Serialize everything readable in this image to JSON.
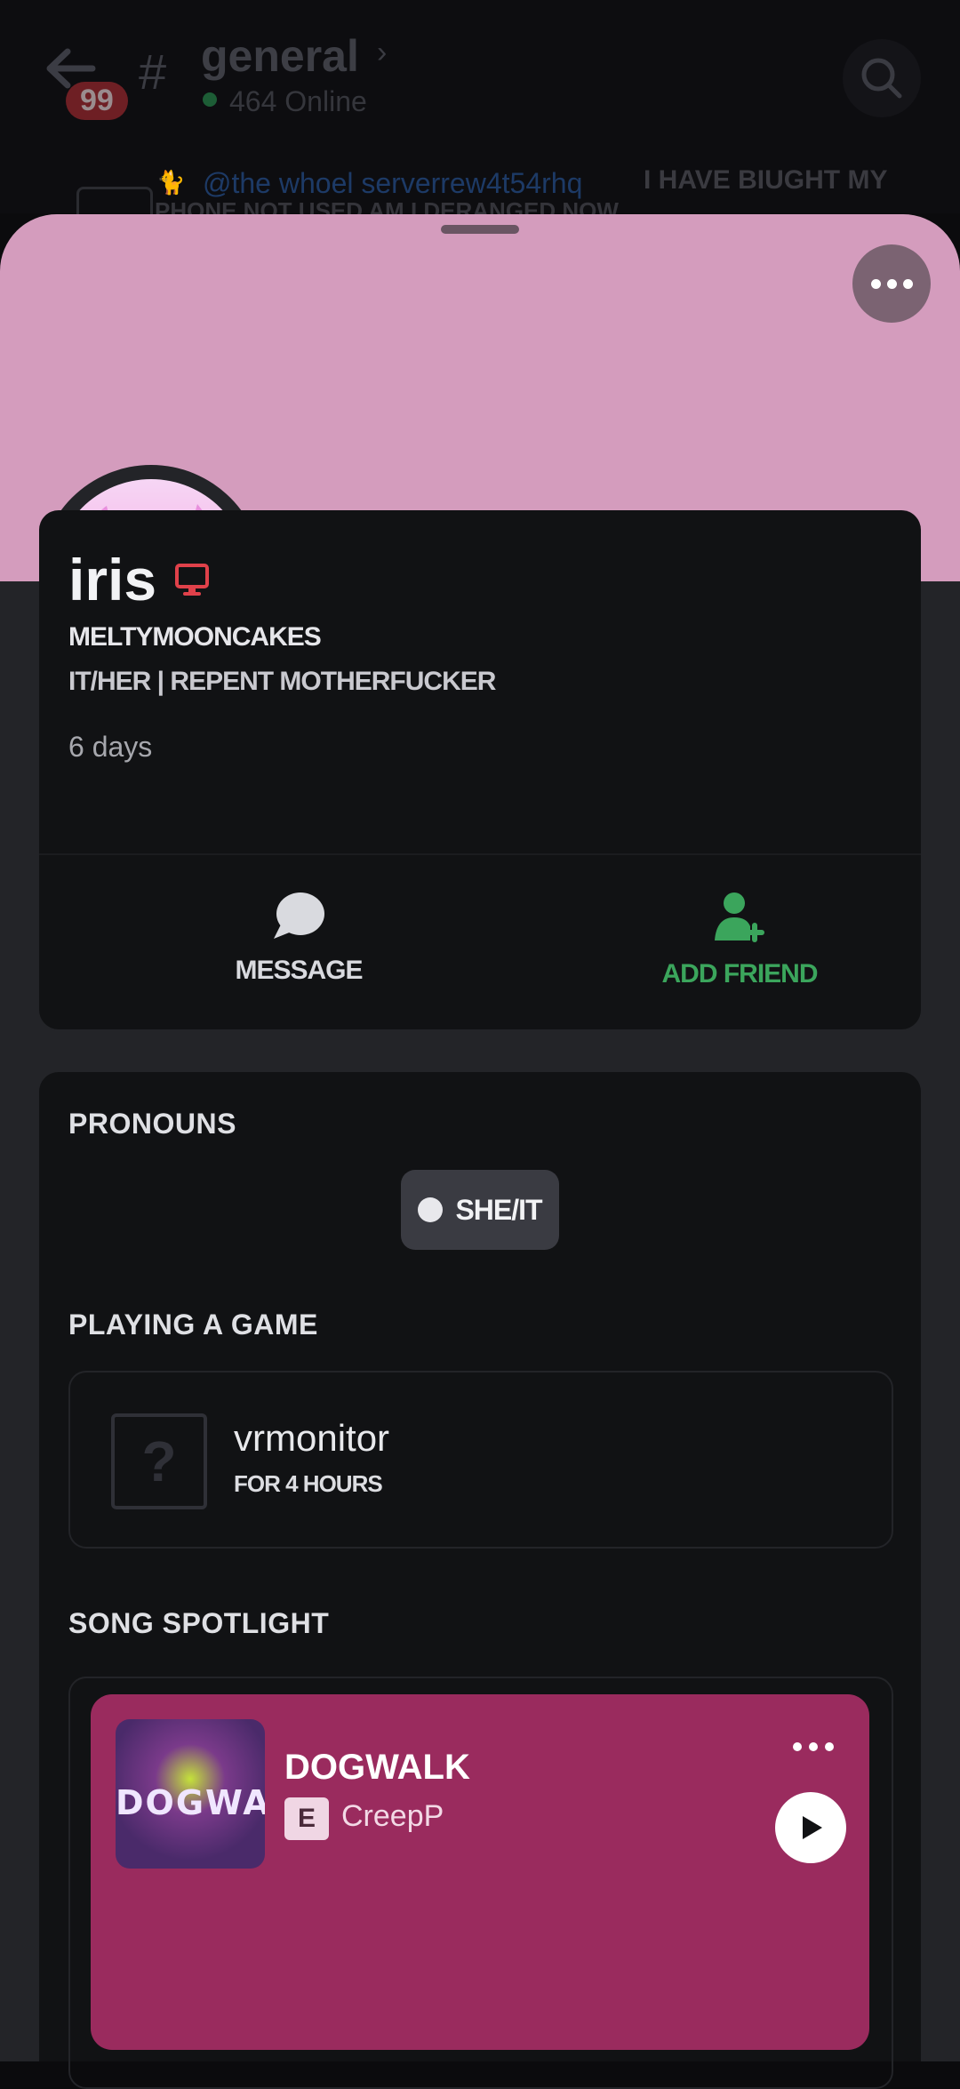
{
  "background": {
    "back_icon": "arrow-left-icon",
    "unread_count": "99",
    "channel_hash": "#",
    "channel_name": "general",
    "online_count": "464 Online",
    "mention": "@the whoel serverrew4t54rhq",
    "message_tail": "I HAVE BIUGHT MY",
    "message_line2": "PHONE NOT USED AM I DERANGED NOW"
  },
  "profile": {
    "display_name": "iris",
    "username": "MELTYMOONCAKES",
    "bio": "IT/HER | REPENT MOTHERFUCKER",
    "member_since": "6 days",
    "status": "do-not-disturb",
    "platform_icon": "desktop-icon"
  },
  "actions": {
    "message_label": "MESSAGE",
    "add_friend_label": "ADD FRIEND"
  },
  "sections": {
    "pronouns_title": "PRONOUNS",
    "pronoun_value": "SHE/IT",
    "game_title": "PLAYING A GAME",
    "game_name": "vrmonitor",
    "game_duration": "FOR 4 HOURS",
    "song_title": "SONG SPOTLIGHT"
  },
  "song": {
    "title": "DOGWALK",
    "explicit": "E",
    "artist": "CreepP",
    "album_text": "DOGWALK"
  },
  "colors": {
    "banner": "#d49cbd",
    "accent_green": "#3ba55c",
    "dnd_red": "#e0414a",
    "song_card": "#9a2b5e"
  }
}
